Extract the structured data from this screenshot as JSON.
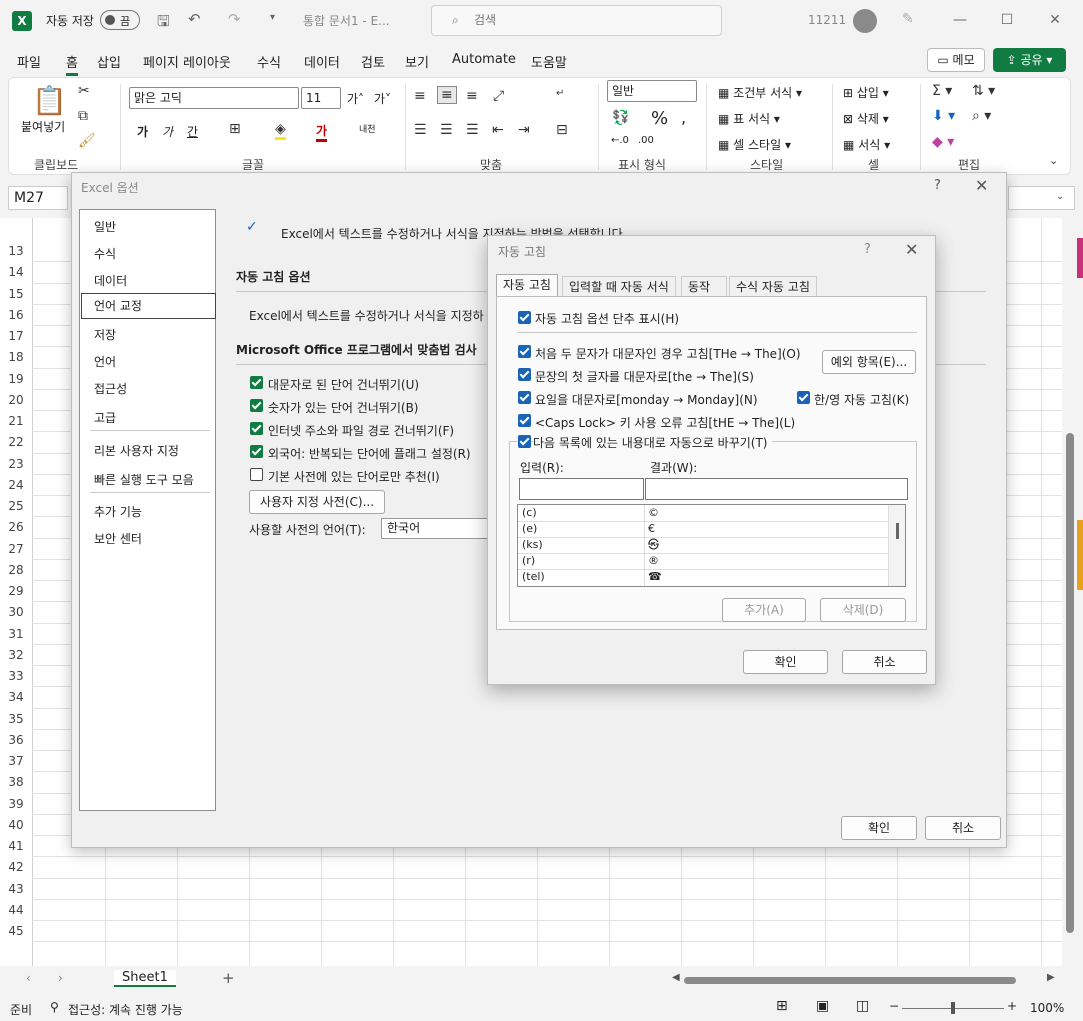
{
  "titlebar": {
    "autosave_label": "자동 저장",
    "autosave_state": "끔",
    "doc_title": "통합 문서1 - E...",
    "search_placeholder": "검색",
    "user_id": "11211"
  },
  "menu": {
    "items": [
      "파일",
      "홈",
      "삽입",
      "페이지 레이아웃",
      "수식",
      "데이터",
      "검토",
      "보기",
      "Automate",
      "도움말"
    ],
    "active": "홈",
    "memo_label": "메모",
    "share_label": "공유"
  },
  "ribbon": {
    "paste_label": "붙여넣기",
    "font_name": "맑은 고딕",
    "font_size": "11",
    "number_format": "일반",
    "conditional_format": "조건부 서식",
    "table_format": "표 서식",
    "cell_style": "셀 스타일",
    "insert": "삽입",
    "delete": "삭제",
    "format": "서식",
    "groups": [
      "클립보드",
      "글꼴",
      "맞춤",
      "표시 형식",
      "스타일",
      "셀",
      "편집"
    ]
  },
  "namebox": "M27",
  "sheet": {
    "rows": [
      "13",
      "14",
      "15",
      "16",
      "17",
      "18",
      "19",
      "20",
      "21",
      "22",
      "23",
      "24",
      "25",
      "26",
      "27",
      "28",
      "29",
      "30",
      "31",
      "32",
      "33",
      "34",
      "35",
      "36",
      "37",
      "38",
      "39",
      "40",
      "41",
      "42",
      "43",
      "44",
      "45"
    ],
    "tab": "Sheet1"
  },
  "status": {
    "ready": "준비",
    "accessibility": "접근성: 계속 진행 가능",
    "zoom": "100%"
  },
  "options_dialog": {
    "title": "Excel 옵션",
    "help": "?",
    "nav": [
      "일반",
      "수식",
      "데이터",
      "언어 교정",
      "저장",
      "언어",
      "접근성",
      "고급",
      "리본 사용자 지정",
      "빠른 실행 도구 모음",
      "추가 기능",
      "보안 센터"
    ],
    "nav_selected": "언어 교정",
    "header_text": "Excel에서 텍스트를 수정하거나 서식을 지정하는 방법을 선택합니다",
    "autocorrect_section": "자동 고침 옵션",
    "autocorrect_desc": "Excel에서 텍스트를 수정하거나 서식을 지정하",
    "spell_section": "Microsoft Office 프로그램에서 맞춤법 검사",
    "checks": [
      {
        "label": "대문자로 된 단어 건너뛰기(U)",
        "checked": true
      },
      {
        "label": "숫자가 있는 단어 건너뛰기(B)",
        "checked": true
      },
      {
        "label": "인터넷 주소와 파일 경로 건너뛰기(F)",
        "checked": true
      },
      {
        "label": "외국어: 반복되는 단어에 플래그 설정(R)",
        "checked": true
      },
      {
        "label": "기본 사전에 있는 단어로만 추천(I)",
        "checked": false
      }
    ],
    "custom_dict_button": "사용자 지정 사전(C)...",
    "dict_lang_label": "사용할 사전의 언어(T):",
    "dict_lang_value": "한국어",
    "ok": "확인",
    "cancel": "취소"
  },
  "autocorrect_dialog": {
    "title": "자동 고침",
    "help": "?",
    "tabs": [
      "자동 고침",
      "입력할 때 자동 서식",
      "동작",
      "수식 자동 고침"
    ],
    "show_buttons": "자동 고침 옵션 단추 표시(H)",
    "opt1": "처음 두 문자가 대문자인 경우 고침[THe → The](O)",
    "opt2": "문장의 첫 글자를 대문자로[the → The](S)",
    "opt3": "요일을 대문자로[monday → Monday](N)",
    "opt4": "<Caps Lock> 키 사용 오류 고침[tHE → The](L)",
    "opt5": "다음 목록에 있는 내용대로 자동으로 바꾸기(T)",
    "hanyoung": "한/영 자동 고침(K)",
    "exceptions_button": "예외 항목(E)...",
    "input_label": "입력(R):",
    "result_label": "결과(W):",
    "list": [
      {
        "key": "(c)",
        "value": "©"
      },
      {
        "key": "(e)",
        "value": "€"
      },
      {
        "key": "(ks)",
        "value": "㉿"
      },
      {
        "key": "(r)",
        "value": "®"
      },
      {
        "key": "(tel)",
        "value": "☎"
      }
    ],
    "add_button": "추가(A)",
    "delete_button": "삭제(D)",
    "ok": "확인",
    "cancel": "취소"
  }
}
